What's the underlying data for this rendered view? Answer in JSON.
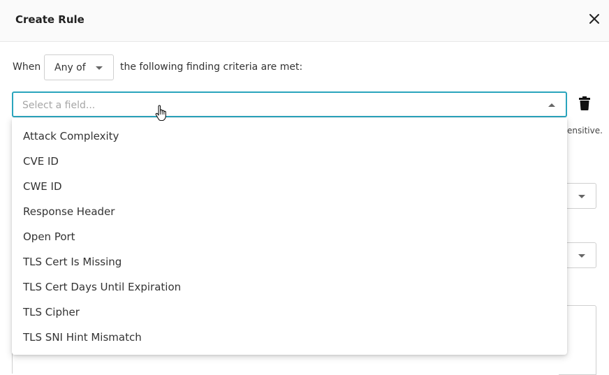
{
  "modal": {
    "title": "Create Rule",
    "close_icon": "close-icon"
  },
  "rule": {
    "when_label": "When",
    "match_select_value": "Any of",
    "criteria_text": "the following finding criteria are met:"
  },
  "field_select": {
    "placeholder": "Select a field...",
    "options": [
      "Attack Complexity",
      "CVE ID",
      "CWE ID",
      "Response Header",
      "Open Port",
      "TLS Cert Is Missing",
      "TLS Cert Days Until Expiration",
      "TLS Cipher",
      "TLS SNI Hint Mismatch"
    ]
  },
  "partial_hint": "ensitive.",
  "icons": {
    "delete": "trash-icon",
    "pointer": "hand-cursor-icon"
  },
  "colors": {
    "focus_border": "#2aa5bd",
    "header_bg": "#fafafa"
  }
}
